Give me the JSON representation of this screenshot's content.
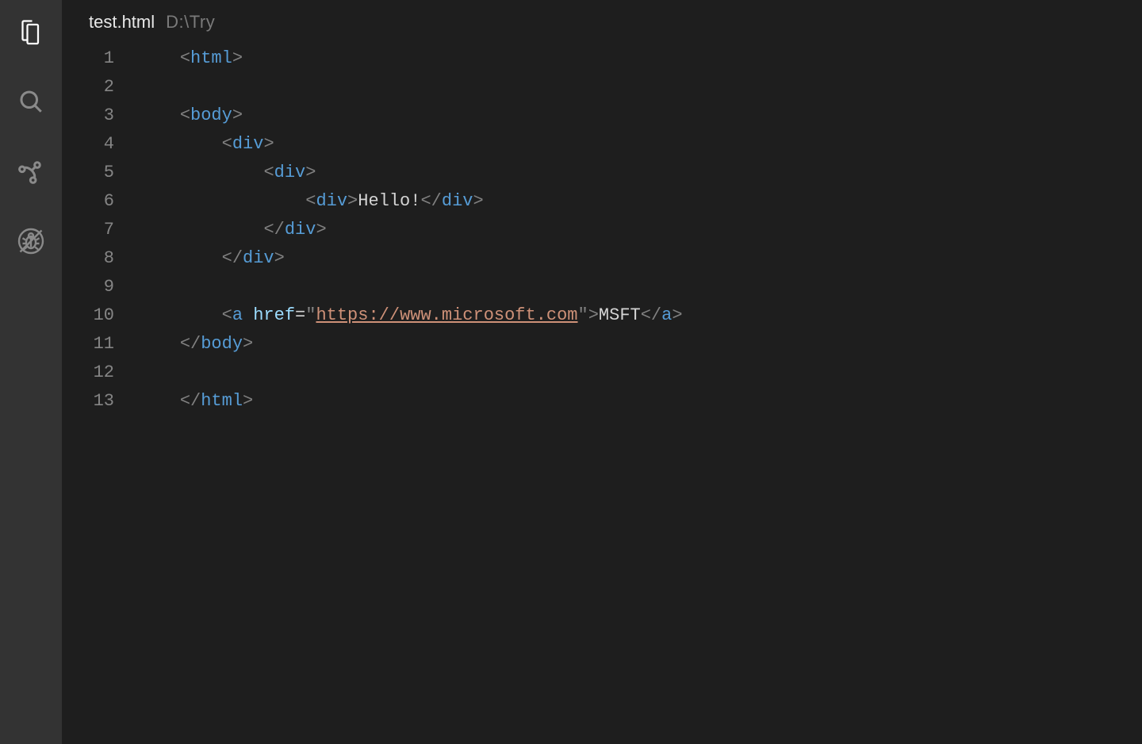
{
  "activityBar": {
    "items": [
      {
        "name": "explorer-icon",
        "active": true
      },
      {
        "name": "search-icon",
        "active": false
      },
      {
        "name": "source-control-icon",
        "active": false
      },
      {
        "name": "debug-icon",
        "active": false
      }
    ]
  },
  "header": {
    "fileName": "test.html",
    "filePath": "D:\\Try"
  },
  "gutter": {
    "start": 1,
    "end": 13
  },
  "code": {
    "lines": [
      {
        "indent": 0,
        "tokens": [
          {
            "t": "bracket",
            "v": "<"
          },
          {
            "t": "tag",
            "v": "html"
          },
          {
            "t": "bracket",
            "v": ">"
          }
        ]
      },
      {
        "indent": 0,
        "tokens": []
      },
      {
        "indent": 0,
        "tokens": [
          {
            "t": "bracket",
            "v": "<"
          },
          {
            "t": "tag",
            "v": "body"
          },
          {
            "t": "bracket",
            "v": ">"
          }
        ]
      },
      {
        "indent": 1,
        "tokens": [
          {
            "t": "bracket",
            "v": "<"
          },
          {
            "t": "tag",
            "v": "div"
          },
          {
            "t": "bracket",
            "v": ">"
          }
        ]
      },
      {
        "indent": 2,
        "tokens": [
          {
            "t": "bracket",
            "v": "<"
          },
          {
            "t": "tag",
            "v": "div"
          },
          {
            "t": "bracket",
            "v": ">"
          }
        ]
      },
      {
        "indent": 3,
        "tokens": [
          {
            "t": "bracket",
            "v": "<"
          },
          {
            "t": "tag",
            "v": "div"
          },
          {
            "t": "bracket",
            "v": ">"
          },
          {
            "t": "text",
            "v": "Hello!"
          },
          {
            "t": "bracket",
            "v": "</"
          },
          {
            "t": "tag",
            "v": "div"
          },
          {
            "t": "bracket",
            "v": ">"
          }
        ]
      },
      {
        "indent": 2,
        "tokens": [
          {
            "t": "bracket",
            "v": "</"
          },
          {
            "t": "tag",
            "v": "div"
          },
          {
            "t": "bracket",
            "v": ">"
          }
        ]
      },
      {
        "indent": 1,
        "tokens": [
          {
            "t": "bracket",
            "v": "</"
          },
          {
            "t": "tag",
            "v": "div"
          },
          {
            "t": "bracket",
            "v": ">"
          }
        ]
      },
      {
        "indent": 0,
        "tokens": []
      },
      {
        "indent": 1,
        "tokens": [
          {
            "t": "bracket",
            "v": "<"
          },
          {
            "t": "tag",
            "v": "a"
          },
          {
            "t": "text",
            "v": " "
          },
          {
            "t": "attr",
            "v": "href"
          },
          {
            "t": "op",
            "v": "="
          },
          {
            "t": "quote",
            "v": "\""
          },
          {
            "t": "url",
            "v": "https://www.microsoft.com"
          },
          {
            "t": "quote",
            "v": "\""
          },
          {
            "t": "bracket",
            "v": ">"
          },
          {
            "t": "text",
            "v": "MSFT"
          },
          {
            "t": "bracket",
            "v": "</"
          },
          {
            "t": "tag",
            "v": "a"
          },
          {
            "t": "bracket",
            "v": ">"
          }
        ]
      },
      {
        "indent": 0,
        "tokens": [
          {
            "t": "bracket",
            "v": "</"
          },
          {
            "t": "tag",
            "v": "body"
          },
          {
            "t": "bracket",
            "v": ">"
          }
        ]
      },
      {
        "indent": 0,
        "tokens": []
      },
      {
        "indent": 0,
        "tokens": [
          {
            "t": "bracket",
            "v": "</"
          },
          {
            "t": "tag",
            "v": "html"
          },
          {
            "t": "bracket",
            "v": ">"
          }
        ]
      }
    ]
  }
}
